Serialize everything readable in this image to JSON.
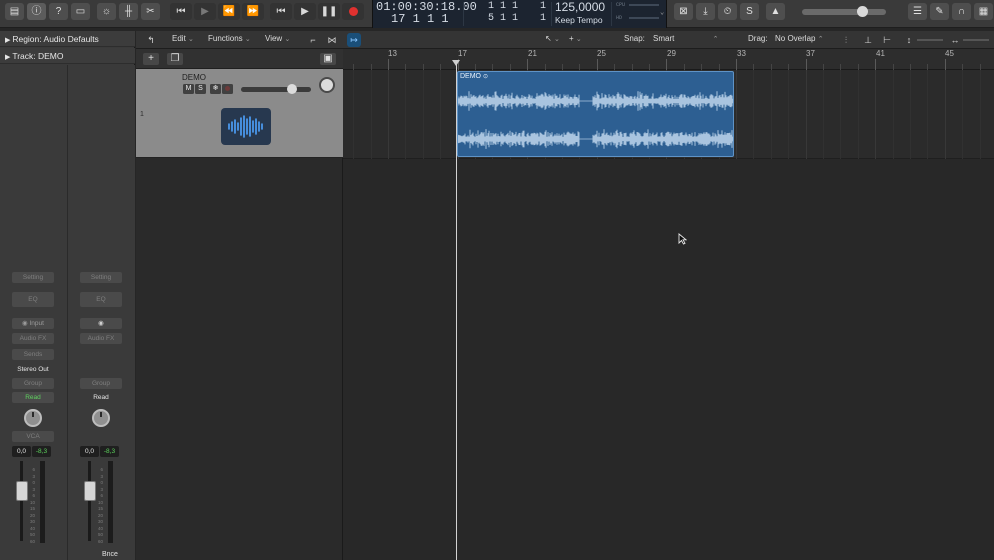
{
  "transport": {
    "position_time": "01:00:30:18.00",
    "position_bars": "17  1  1       1",
    "end_bars_top": "1  1  1",
    "end_bars_bottom": "5  1  1",
    "end_count_top": "1",
    "end_count_bottom": "1",
    "tempo": "125,0000",
    "tempo_mode": "Keep Tempo",
    "cpu_label": "CPU",
    "hd_label": "HD"
  },
  "inspector": {
    "region_label": "Region: Audio Defaults",
    "track_label": "Track: DEMO"
  },
  "channel_strip_1": {
    "setting": "Setting",
    "eq": "EQ",
    "input": "Input",
    "audio_fx": "Audio FX",
    "sends": "Sends",
    "output": "Stereo Out",
    "group": "Group",
    "automation": "Read",
    "vca": "VCA",
    "volume": "0,0",
    "peak": "-8,3"
  },
  "channel_strip_2": {
    "setting": "Setting",
    "eq": "EQ",
    "audio_fx": "Audio FX",
    "group": "Group",
    "automation": "Read",
    "volume": "0,0",
    "peak": "-8,3",
    "name": "Bnce"
  },
  "tracks_toolbar": {
    "edit": "Edit",
    "functions": "Functions",
    "view": "View",
    "snap_label": "Snap:",
    "snap_value": "Smart",
    "drag_label": "Drag:",
    "drag_value": "No Overlap"
  },
  "track": {
    "number": "1",
    "name": "DEMO",
    "mute": "M",
    "solo": "S"
  },
  "ruler": {
    "bars": [
      "13",
      "17",
      "21",
      "25",
      "29",
      "33",
      "37",
      "41",
      "45"
    ]
  },
  "region": {
    "name": "DEMO"
  },
  "colors": {
    "region_fill": "#2d5f92",
    "track_icon_wave": "#4ea3ff",
    "record": "#e0312f",
    "automation_read": "#5fd25f"
  }
}
